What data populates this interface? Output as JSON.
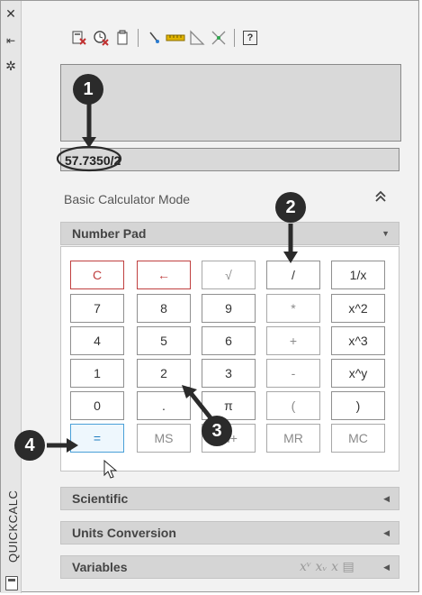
{
  "sidebar": {
    "label": "QUICKCALC",
    "buttons": [
      "close-icon",
      "auto-hide-icon",
      "properties-icon"
    ],
    "glyphs": {
      "close": "✕",
      "autohide": "⇤",
      "properties": "✲"
    }
  },
  "toolbar": {
    "items": [
      "clear-icon",
      "clear-history-icon",
      "paste-icon",
      "get-coordinates-icon",
      "distance-icon",
      "angle-icon",
      "intersection-icon",
      "help-icon"
    ],
    "help_glyph": "?"
  },
  "input": {
    "value": "57.7350/2"
  },
  "mode": {
    "label": "Basic Calculator Mode",
    "collapse_glyph": "⌃"
  },
  "number_pad": {
    "title": "Number Pad",
    "arrow": "▼",
    "keys": [
      [
        "C",
        "←",
        "√",
        "/",
        "1/x"
      ],
      [
        "7",
        "8",
        "9",
        "*",
        "x^2"
      ],
      [
        "4",
        "5",
        "6",
        "+",
        "x^3"
      ],
      [
        "1",
        "2",
        "3",
        "-",
        "x^y"
      ],
      [
        "0",
        ".",
        "π",
        "(",
        ")"
      ],
      [
        "=",
        "MS",
        "M+",
        "MR",
        "MC"
      ]
    ]
  },
  "sections": [
    {
      "title": "Scientific",
      "arrow": "◀"
    },
    {
      "title": "Units Conversion",
      "arrow": "◀"
    },
    {
      "title": "Variables",
      "arrow": "◀"
    }
  ],
  "variables_icons": "𝑥ᵛ 𝑥ᵥ 𝑥 ▤",
  "callouts": [
    "1",
    "2",
    "3",
    "4"
  ],
  "colors": {
    "red": "#c04040",
    "accent": "#4aa0d8",
    "callout": "#2b2b2b"
  }
}
